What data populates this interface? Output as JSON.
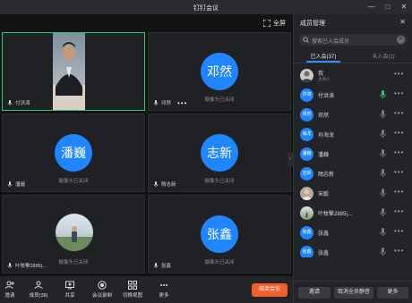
{
  "window": {
    "title": "钉钉会议"
  },
  "video": {
    "fullscreen_label": "全屏",
    "camera_off_text": "摄像头已关闭",
    "tiles": [
      {
        "name": "付洪涛",
        "type": "video"
      },
      {
        "name": "邓然",
        "avatar": "邓然",
        "type": "avatar"
      },
      {
        "name": "潘巍",
        "avatar": "潘巍",
        "type": "avatar"
      },
      {
        "name": "隋志新",
        "avatar": "志新",
        "type": "avatar"
      },
      {
        "name": "叶牧擊2885|...",
        "type": "photo"
      },
      {
        "name": "张鑫",
        "avatar": "张鑫",
        "type": "avatar"
      }
    ]
  },
  "toolbar": {
    "buttons": [
      {
        "label": "邀请",
        "icon": "invite-icon"
      },
      {
        "label": "成员(38)",
        "icon": "members-icon"
      },
      {
        "label": "共享",
        "icon": "share-icon"
      },
      {
        "label": "会议录制",
        "icon": "record-icon"
      },
      {
        "label": "切换视图",
        "icon": "grid-view-icon"
      },
      {
        "label": "更多",
        "icon": "more-icon"
      }
    ],
    "end_label": "结束会议"
  },
  "panel": {
    "title": "成员管理",
    "search_placeholder": "搜索已入会成员",
    "tabs": [
      {
        "label": "已入会(37)"
      },
      {
        "label": "未入会(1)"
      }
    ],
    "members": [
      {
        "name": "我",
        "sub": "主持人",
        "avatar": "",
        "mic": "none"
      },
      {
        "name": "付洪涛",
        "sub": "",
        "avatar": "洪涛",
        "mic": "active"
      },
      {
        "name": "邓然",
        "sub": "",
        "avatar": "邓然",
        "mic": "muted"
      },
      {
        "name": "孙海龙",
        "sub": "",
        "avatar": "海龙",
        "mic": "muted"
      },
      {
        "name": "潘巍",
        "sub": "",
        "avatar": "潘巍",
        "mic": "muted"
      },
      {
        "name": "隋志新",
        "sub": "",
        "avatar": "志新",
        "mic": "muted"
      },
      {
        "name": "宋毅",
        "sub": "",
        "avatar": "",
        "mic": "muted"
      },
      {
        "name": "叶牧擊2885|...",
        "sub": "",
        "avatar": "",
        "mic": "muted"
      },
      {
        "name": "张鑫",
        "sub": "",
        "avatar": "张鑫",
        "mic": "muted"
      },
      {
        "name": "张鑫",
        "sub": "",
        "avatar": "张鑫",
        "mic": "muted"
      }
    ],
    "bottom_buttons": [
      {
        "label": "邀请"
      },
      {
        "label": "取消全员静音"
      },
      {
        "label": "更多"
      }
    ]
  },
  "colors": {
    "accent": "#1f86ff",
    "end": "#f25f2c",
    "speaking": "#3cc36f"
  }
}
